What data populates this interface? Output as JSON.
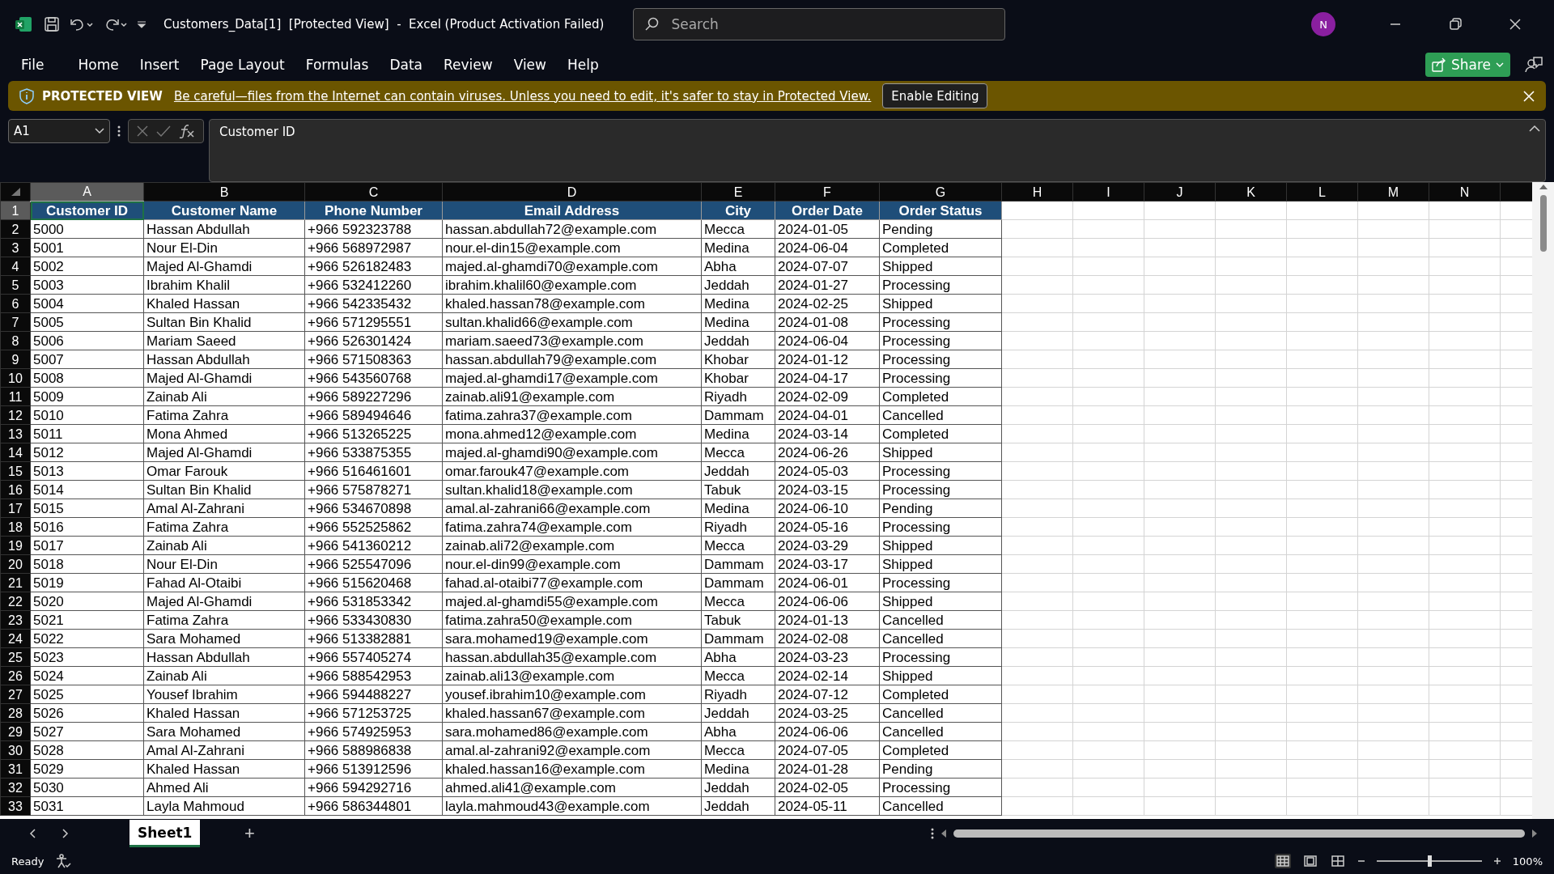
{
  "window": {
    "title": "Customers_Data[1]  [Protected View]  -  Excel (Product Activation Failed)",
    "search": {
      "placeholder": "Search"
    },
    "avatar": "N"
  },
  "menu": [
    {
      "label": "File",
      "selected": false
    },
    {
      "label": "Home",
      "selected": false
    },
    {
      "label": "Insert",
      "selected": false
    },
    {
      "label": "Page Layout",
      "selected": false
    },
    {
      "label": "Formulas",
      "selected": false
    },
    {
      "label": "Data",
      "selected": false
    },
    {
      "label": "Review",
      "selected": false
    },
    {
      "label": "View",
      "selected": false
    },
    {
      "label": "Help",
      "selected": false
    }
  ],
  "share_button": "Share",
  "protected_bar": {
    "label": "PROTECTED VIEW",
    "message": "Be careful—files from the Internet can contain viruses. Unless you need to edit, it's safer to stay in Protected View.",
    "button": "Enable Editing"
  },
  "formula_bar": {
    "name_box": "A1",
    "formula": "Customer ID"
  },
  "columns": [
    {
      "label": "A",
      "selected": true
    },
    {
      "label": "B",
      "selected": false
    },
    {
      "label": "C",
      "selected": false
    },
    {
      "label": "D",
      "selected": false
    },
    {
      "label": "E",
      "selected": false
    },
    {
      "label": "F",
      "selected": false
    },
    {
      "label": "G",
      "selected": false
    },
    {
      "label": "H",
      "selected": false
    },
    {
      "label": "I",
      "selected": false
    },
    {
      "label": "J",
      "selected": false
    },
    {
      "label": "K",
      "selected": false
    },
    {
      "label": "L",
      "selected": false
    },
    {
      "label": "M",
      "selected": false
    },
    {
      "label": "N",
      "selected": false
    }
  ],
  "rows": [
    {
      "number": "1",
      "selected": true,
      "kind": "header",
      "cells": [
        "Customer ID",
        "Customer Name",
        "Phone Number",
        "Email Address",
        "City",
        "Order Date",
        "Order Status"
      ]
    },
    {
      "number": "2",
      "selected": false,
      "kind": "data",
      "cells": [
        "5000",
        "Hassan Abdullah",
        "+966 592323788",
        "hassan.abdullah72@example.com",
        "Mecca",
        "2024-01-05",
        "Pending"
      ]
    },
    {
      "number": "3",
      "selected": false,
      "kind": "data",
      "cells": [
        "5001",
        "Nour El-Din",
        "+966 568972987",
        "nour.el-din15@example.com",
        "Medina",
        "2024-06-04",
        "Completed"
      ]
    },
    {
      "number": "4",
      "selected": false,
      "kind": "data",
      "cells": [
        "5002",
        "Majed Al-Ghamdi",
        "+966 526182483",
        "majed.al-ghamdi70@example.com",
        "Abha",
        "2024-07-07",
        "Shipped"
      ]
    },
    {
      "number": "5",
      "selected": false,
      "kind": "data",
      "cells": [
        "5003",
        "Ibrahim Khalil",
        "+966 532412260",
        "ibrahim.khalil60@example.com",
        "Jeddah",
        "2024-01-27",
        "Processing"
      ]
    },
    {
      "number": "6",
      "selected": false,
      "kind": "data",
      "cells": [
        "5004",
        "Khaled Hassan",
        "+966 542335432",
        "khaled.hassan78@example.com",
        "Medina",
        "2024-02-25",
        "Shipped"
      ]
    },
    {
      "number": "7",
      "selected": false,
      "kind": "data",
      "cells": [
        "5005",
        "Sultan Bin Khalid",
        "+966 571295551",
        "sultan.khalid66@example.com",
        "Medina",
        "2024-01-08",
        "Processing"
      ]
    },
    {
      "number": "8",
      "selected": false,
      "kind": "data",
      "cells": [
        "5006",
        "Mariam Saeed",
        "+966 526301424",
        "mariam.saeed73@example.com",
        "Jeddah",
        "2024-06-04",
        "Processing"
      ]
    },
    {
      "number": "9",
      "selected": false,
      "kind": "data",
      "cells": [
        "5007",
        "Hassan Abdullah",
        "+966 571508363",
        "hassan.abdullah79@example.com",
        "Khobar",
        "2024-01-12",
        "Processing"
      ]
    },
    {
      "number": "10",
      "selected": false,
      "kind": "data",
      "cells": [
        "5008",
        "Majed Al-Ghamdi",
        "+966 543560768",
        "majed.al-ghamdi17@example.com",
        "Khobar",
        "2024-04-17",
        "Processing"
      ]
    },
    {
      "number": "11",
      "selected": false,
      "kind": "data",
      "cells": [
        "5009",
        "Zainab Ali",
        "+966 589227296",
        "zainab.ali91@example.com",
        "Riyadh",
        "2024-02-09",
        "Completed"
      ]
    },
    {
      "number": "12",
      "selected": false,
      "kind": "data",
      "cells": [
        "5010",
        "Fatima Zahra",
        "+966 589494646",
        "fatima.zahra37@example.com",
        "Dammam",
        "2024-04-01",
        "Cancelled"
      ]
    },
    {
      "number": "13",
      "selected": false,
      "kind": "data",
      "cells": [
        "5011",
        "Mona Ahmed",
        "+966 513265225",
        "mona.ahmed12@example.com",
        "Medina",
        "2024-03-14",
        "Completed"
      ]
    },
    {
      "number": "14",
      "selected": false,
      "kind": "data",
      "cells": [
        "5012",
        "Majed Al-Ghamdi",
        "+966 533875355",
        "majed.al-ghamdi90@example.com",
        "Mecca",
        "2024-06-26",
        "Shipped"
      ]
    },
    {
      "number": "15",
      "selected": false,
      "kind": "data",
      "cells": [
        "5013",
        "Omar Farouk",
        "+966 516461601",
        "omar.farouk47@example.com",
        "Jeddah",
        "2024-05-03",
        "Processing"
      ]
    },
    {
      "number": "16",
      "selected": false,
      "kind": "data",
      "cells": [
        "5014",
        "Sultan Bin Khalid",
        "+966 575878271",
        "sultan.khalid18@example.com",
        "Tabuk",
        "2024-03-15",
        "Processing"
      ]
    },
    {
      "number": "17",
      "selected": false,
      "kind": "data",
      "cells": [
        "5015",
        "Amal Al-Zahrani",
        "+966 534670898",
        "amal.al-zahrani66@example.com",
        "Medina",
        "2024-06-10",
        "Pending"
      ]
    },
    {
      "number": "18",
      "selected": false,
      "kind": "data",
      "cells": [
        "5016",
        "Fatima Zahra",
        "+966 552525862",
        "fatima.zahra74@example.com",
        "Riyadh",
        "2024-05-16",
        "Processing"
      ]
    },
    {
      "number": "19",
      "selected": false,
      "kind": "data",
      "cells": [
        "5017",
        "Zainab Ali",
        "+966 541360212",
        "zainab.ali72@example.com",
        "Mecca",
        "2024-03-29",
        "Shipped"
      ]
    },
    {
      "number": "20",
      "selected": false,
      "kind": "data",
      "cells": [
        "5018",
        "Nour El-Din",
        "+966 525547096",
        "nour.el-din99@example.com",
        "Dammam",
        "2024-03-17",
        "Shipped"
      ]
    },
    {
      "number": "21",
      "selected": false,
      "kind": "data",
      "cells": [
        "5019",
        "Fahad Al-Otaibi",
        "+966 515620468",
        "fahad.al-otaibi77@example.com",
        "Dammam",
        "2024-06-01",
        "Processing"
      ]
    },
    {
      "number": "22",
      "selected": false,
      "kind": "data",
      "cells": [
        "5020",
        "Majed Al-Ghamdi",
        "+966 531853342",
        "majed.al-ghamdi55@example.com",
        "Mecca",
        "2024-06-06",
        "Shipped"
      ]
    },
    {
      "number": "23",
      "selected": false,
      "kind": "data",
      "cells": [
        "5021",
        "Fatima Zahra",
        "+966 533430830",
        "fatima.zahra50@example.com",
        "Tabuk",
        "2024-01-13",
        "Cancelled"
      ]
    },
    {
      "number": "24",
      "selected": false,
      "kind": "data",
      "cells": [
        "5022",
        "Sara Mohamed",
        "+966 513382881",
        "sara.mohamed19@example.com",
        "Dammam",
        "2024-02-08",
        "Cancelled"
      ]
    },
    {
      "number": "25",
      "selected": false,
      "kind": "data",
      "cells": [
        "5023",
        "Hassan Abdullah",
        "+966 557405274",
        "hassan.abdullah35@example.com",
        "Abha",
        "2024-03-23",
        "Processing"
      ]
    },
    {
      "number": "26",
      "selected": false,
      "kind": "data",
      "cells": [
        "5024",
        "Zainab Ali",
        "+966 588542953",
        "zainab.ali13@example.com",
        "Mecca",
        "2024-02-14",
        "Shipped"
      ]
    },
    {
      "number": "27",
      "selected": false,
      "kind": "data",
      "cells": [
        "5025",
        "Yousef Ibrahim",
        "+966 594488227",
        "yousef.ibrahim10@example.com",
        "Riyadh",
        "2024-07-12",
        "Completed"
      ]
    },
    {
      "number": "28",
      "selected": false,
      "kind": "data",
      "cells": [
        "5026",
        "Khaled Hassan",
        "+966 571253725",
        "khaled.hassan67@example.com",
        "Jeddah",
        "2024-03-25",
        "Cancelled"
      ]
    },
    {
      "number": "29",
      "selected": false,
      "kind": "data",
      "cells": [
        "5027",
        "Sara Mohamed",
        "+966 574925953",
        "sara.mohamed86@example.com",
        "Abha",
        "2024-06-06",
        "Cancelled"
      ]
    },
    {
      "number": "30",
      "selected": false,
      "kind": "data",
      "cells": [
        "5028",
        "Amal Al-Zahrani",
        "+966 588986838",
        "amal.al-zahrani92@example.com",
        "Mecca",
        "2024-07-05",
        "Completed"
      ]
    },
    {
      "number": "31",
      "selected": false,
      "kind": "data",
      "cells": [
        "5029",
        "Khaled Hassan",
        "+966 513912596",
        "khaled.hassan16@example.com",
        "Medina",
        "2024-01-28",
        "Pending"
      ]
    },
    {
      "number": "32",
      "selected": false,
      "kind": "data",
      "cells": [
        "5030",
        "Ahmed Ali",
        "+966 594292716",
        "ahmed.ali41@example.com",
        "Jeddah",
        "2024-02-05",
        "Processing"
      ]
    },
    {
      "number": "33",
      "selected": false,
      "kind": "data",
      "cells": [
        "5031",
        "Layla Mahmoud",
        "+966 586344801",
        "layla.mahmoud43@example.com",
        "Jeddah",
        "2024-05-11",
        "Cancelled"
      ]
    }
  ],
  "sheet_tabs": [
    {
      "label": "Sheet1",
      "selected": true
    }
  ],
  "add_sheet": "+",
  "status_bar": {
    "status": "Ready",
    "zoom": "100%",
    "zoom_slider": {
      "level": 0.5
    },
    "views": [
      {
        "kind": "normal",
        "selected": true
      },
      {
        "kind": "page_layout",
        "selected": false
      },
      {
        "kind": "page_break",
        "selected": false
      }
    ]
  }
}
